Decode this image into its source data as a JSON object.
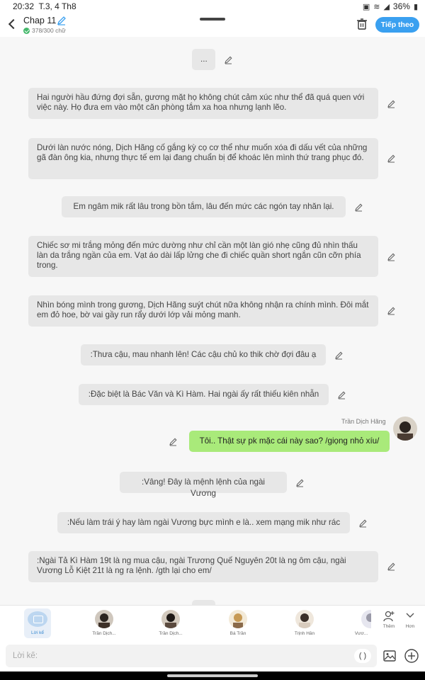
{
  "status": {
    "time": "20:32",
    "date": "T.3, 4 Th8",
    "battery": "36%"
  },
  "header": {
    "title": "Chap 11",
    "count": "378/300 chữ",
    "next_label": "Tiếp theo"
  },
  "messages": [
    {
      "text": "..."
    },
    {
      "text": "Hai người hầu đứng đợi sẵn, gương mặt họ không chút cảm xúc như thể đã quá quen với việc này. Họ đưa em vào một căn phòng tắm xa hoa nhưng lạnh lẽo."
    },
    {
      "text": "Dưới làn nước nóng, Dịch Hãng cố gắng kỳ cọ cơ thể như muốn xóa đi dấu vết của những gã đàn ông kia, nhưng thực tế em lại đang chuẩn bị để khoác lên mình thứ trang phục đó."
    },
    {
      "text": "Em ngâm mik rất lâu trong bồn tắm, lâu đến mức các ngón tay nhăn lại."
    },
    {
      "text": "Chiếc sơ mi trắng mỏng đến mức dường như chỉ cần một làn gió nhẹ cũng đủ nhìn thấu làn da trắng ngần của em. Vạt áo dài lấp lửng che đi chiếc quần short ngắn cũn cỡn phía trong."
    },
    {
      "text": "Nhìn bóng mình trong gương, Dịch Hãng suýt chút nữa không nhận ra chính mình. Đôi mắt em đỏ hoe, bờ vai gầy run rẩy dưới lớp vải mỏng manh."
    },
    {
      "text": ":Thưa cậu, mau nhanh lên! Các cậu chủ ko thik chờ đợi đâu ạ"
    },
    {
      "text": ":Đặc biệt là Bác Văn và Kì Hàm. Hai ngài ấy rất thiếu kiên nhẫn"
    },
    {
      "author": "Trần Dịch Hãng",
      "text": "Tôi.. Thật sự pk mặc cái này sao? /giọng nhỏ xíu/"
    },
    {
      "text": ":Vâng! Đây là mệnh lệnh của ngài Vương"
    },
    {
      "text": ":Nếu làm trái ý hay làm ngài Vương bực mình e là.. xem mạng mik như rác"
    },
    {
      "text": ":Ngài Tả Kì Hàm 19t là ng mua cậu, ngài Trương Quế Nguyên 20t là ng ôm cậu, ngài Vương Lỗ Kiệt 21t là ng ra lệnh. /gth lại cho em/"
    }
  ],
  "characters": [
    {
      "name": "Lời kể"
    },
    {
      "name": "Trần Dịch..."
    },
    {
      "name": "Trần Dịch..."
    },
    {
      "name": "Bá Trần"
    },
    {
      "name": "Trịnh Hân"
    },
    {
      "name": "Vươ..."
    }
  ],
  "actions": {
    "add": "Thêm",
    "more": "Hơn"
  },
  "input": {
    "placeholder": "Lời kể:",
    "paren": "( )"
  },
  "colors": {
    "accent": "#3aa0f0",
    "mine_bubble": "#a9ea7a",
    "bubble": "#e7e7e7"
  }
}
